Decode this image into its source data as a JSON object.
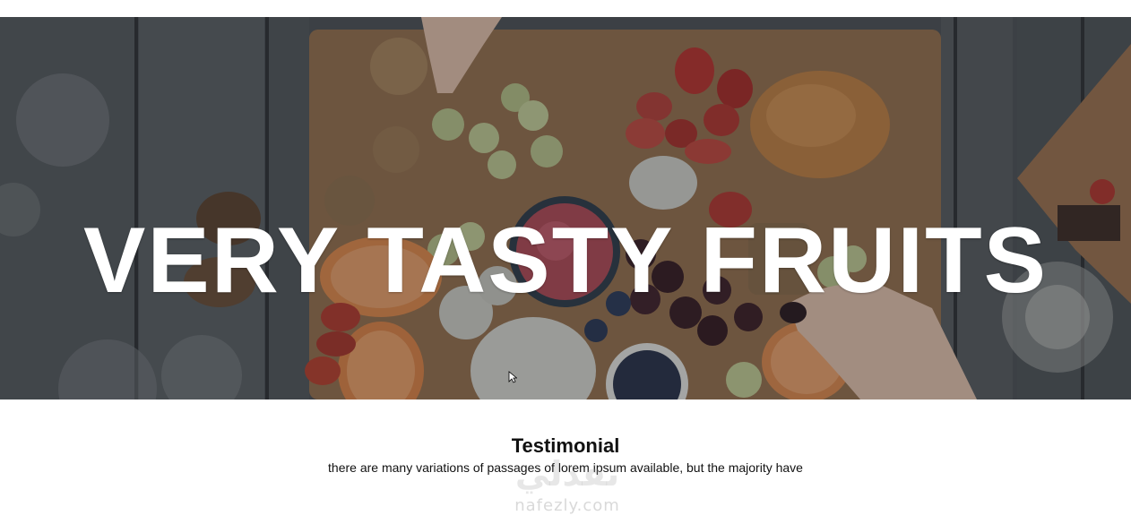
{
  "hero": {
    "title": "VERY TASTY FRUITS",
    "image": "fruit-platter-photo"
  },
  "testimonial": {
    "title": "Testimonial",
    "text": "there are many variations of passages of lorem ipsum available, but the majority have"
  },
  "watermark": {
    "arabic": "نفذلي",
    "url": "nafezly.com"
  },
  "colors": {
    "hero_overlay": "#3d4145",
    "title_text": "#ffffff",
    "body_text": "#111111",
    "page_background": "#ffffff"
  }
}
